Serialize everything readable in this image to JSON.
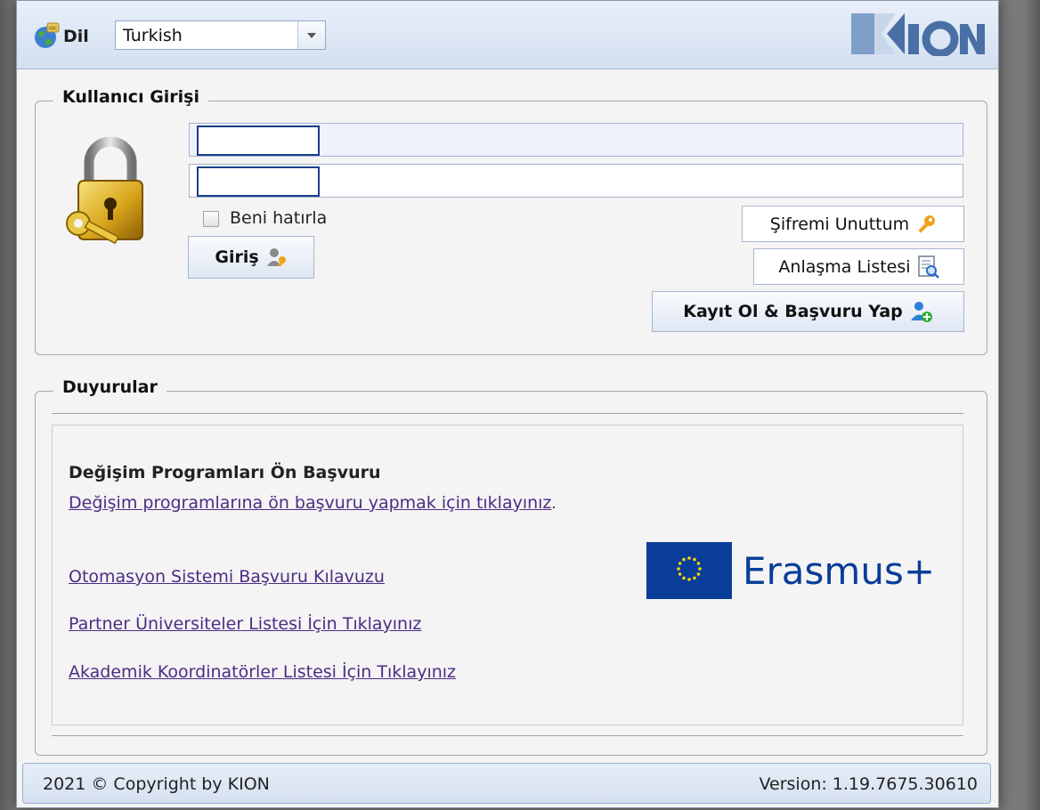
{
  "header": {
    "language_label": "Dil",
    "language_value": "Turkish",
    "logo_text": "KION"
  },
  "login": {
    "legend": "Kullanıcı Girişi",
    "remember_label": "Beni hatırla",
    "submit_label": "Giriş",
    "forgot_label": "Şifremi Unuttum",
    "agreement_label": "Anlaşma Listesi",
    "register_label": "Kayıt Ol & Başvuru Yap"
  },
  "announcements": {
    "legend": "Duyurular",
    "title": "Değişim Programları Ön Başvuru",
    "preapply_link": "Değişim programlarına ön başvuru yapmak için tıklayınız",
    "preapply_suffix": ".",
    "guide_link": "Otomasyon Sistemi Başvuru Kılavuzu",
    "partners_link": "Partner Üniversiteler Listesi İçin Tıklayınız ",
    "coordinators_link": "Akademik Koordinatörler Listesi İçin Tıklayınız",
    "erasmus_text": "Erasmus+"
  },
  "footer": {
    "copyright": "2021 © Copyright by KION",
    "version": "Version: 1.19.7675.30610"
  },
  "colors": {
    "link": "#4c2d84",
    "erasmus_blue": "#0a3d99",
    "kion_logo": "#4a6fa5",
    "header_bg": "#d3dff0"
  }
}
